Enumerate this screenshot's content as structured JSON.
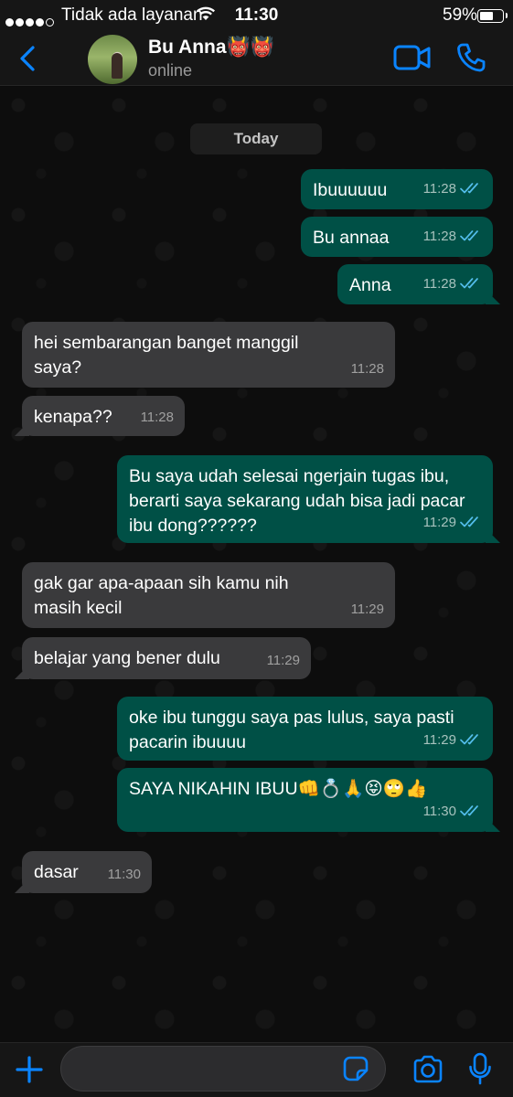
{
  "status_bar": {
    "carrier": "Tidak ada layanan",
    "time": "11:30",
    "battery_percent": "59%",
    "battery_level": 0.59,
    "signal_bars": 4
  },
  "header": {
    "contact_name": "Bu Anna👹👹",
    "status": "online"
  },
  "chat": {
    "date_label": "Today",
    "messages": [
      {
        "dir": "out",
        "text": "Ibuuuuuu",
        "time": "11:28",
        "ticks": "read"
      },
      {
        "dir": "out",
        "text": "Bu annaa",
        "time": "11:28",
        "ticks": "read"
      },
      {
        "dir": "out",
        "text": "Anna",
        "time": "11:28",
        "ticks": "read"
      },
      {
        "dir": "in",
        "text": "hei sembarangan banget manggil saya?",
        "time": "11:28"
      },
      {
        "dir": "in",
        "text": "kenapa??",
        "time": "11:28"
      },
      {
        "dir": "out",
        "text": "Bu saya udah selesai ngerjain tugas ibu, berarti saya sekarang udah bisa jadi pacar ibu dong??????",
        "time": "11:29",
        "ticks": "read"
      },
      {
        "dir": "in",
        "text": "gak gar apa-apaan sih kamu nih masih kecil",
        "time": "11:29"
      },
      {
        "dir": "in",
        "text": "belajar yang bener dulu",
        "time": "11:29"
      },
      {
        "dir": "out",
        "text": "oke ibu tunggu saya pas lulus, saya pasti pacarin ibuuuu",
        "time": "11:29",
        "ticks": "read"
      },
      {
        "dir": "out",
        "text": "SAYA NIKAHIN IBUU👊💍🙏😝🙄👍",
        "time": "11:30",
        "ticks": "read"
      },
      {
        "dir": "in",
        "text": "dasar",
        "time": "11:30"
      }
    ]
  },
  "input": {
    "placeholder": "",
    "value": ""
  },
  "icons": {
    "back": "chevron-left-icon",
    "video": "video-camera-icon",
    "call": "phone-icon",
    "add": "plus-icon",
    "sticker": "sticker-icon",
    "camera": "camera-icon",
    "mic": "microphone-icon"
  },
  "colors": {
    "accent": "#0a84ff",
    "outgoing_bubble": "#005046",
    "incoming_bubble": "#3a3a3c",
    "read_ticks": "#53bdeb"
  }
}
